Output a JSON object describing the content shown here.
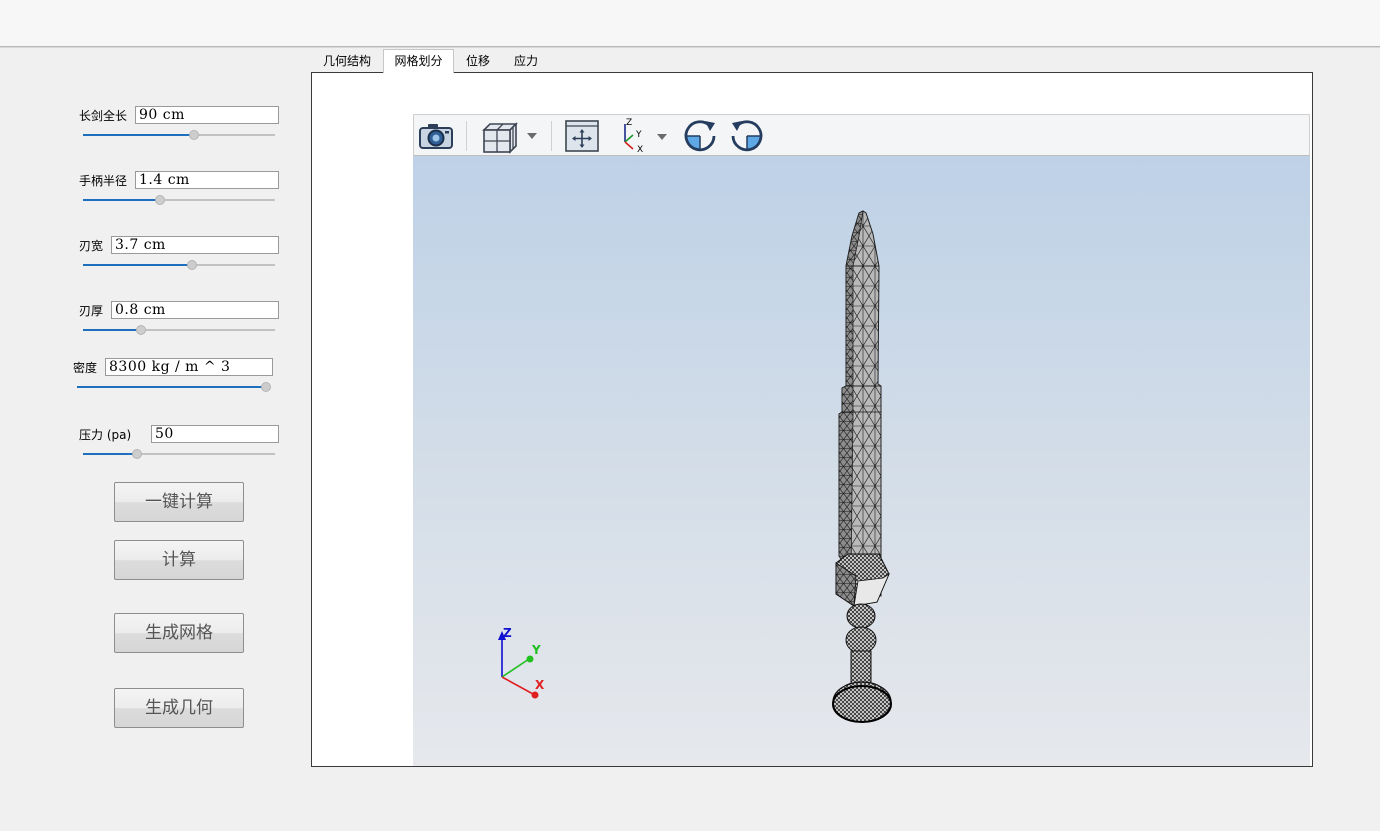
{
  "params": [
    {
      "label": "长剑全长",
      "value": "90 cm",
      "slider": 0.58
    },
    {
      "label": "手柄半径",
      "value": "1.4 cm",
      "slider": 0.4
    },
    {
      "label": "刃宽",
      "value": "3.7 cm",
      "slider": 0.57
    },
    {
      "label": "刃厚",
      "value": "0.8 cm",
      "slider": 0.3
    },
    {
      "label": "密度",
      "value": "8300 kg / m ^ 3",
      "slider": 1.0
    },
    {
      "label": "压力 (pa)",
      "value": "50",
      "slider": 0.28
    }
  ],
  "buttons": {
    "one_click": "一键计算",
    "calculate": "计算",
    "gen_mesh": "生成网格",
    "gen_geometry": "生成几何"
  },
  "tabs": [
    {
      "label": "几何结构",
      "active": false
    },
    {
      "label": "网格划分",
      "active": true
    },
    {
      "label": "位移",
      "active": false
    },
    {
      "label": "应力",
      "active": false
    }
  ],
  "toolbar": {
    "icons": [
      "camera-icon",
      "view-cube-icon",
      "fit-view-icon",
      "axes-orientation-icon",
      "rotate-cw-icon",
      "rotate-ccw-icon"
    ],
    "axes_glyph": {
      "z": "Z",
      "y": "Y",
      "x": "X"
    }
  },
  "triad": {
    "z": "Z",
    "y": "Y",
    "x": "X"
  },
  "colors": {
    "accent": "#1f6fbf",
    "axis_x": "#e02020",
    "axis_y": "#20c020",
    "axis_z": "#1010d0"
  }
}
